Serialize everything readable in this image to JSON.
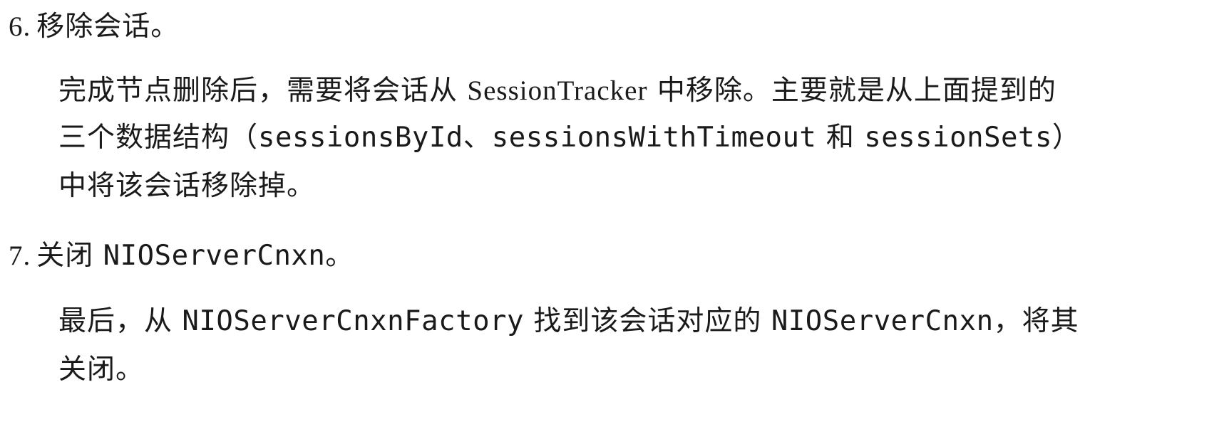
{
  "items": [
    {
      "number": "6.",
      "heading": "移除会话。",
      "body": {
        "line1_a": "完成节点删除后，需要将会话从 ",
        "line1_b": "SessionTracker",
        "line1_c": " 中移除。主要就是从上面提到的",
        "line2_a": "三个数据结构（",
        "line2_b": "sessionsById",
        "line2_c": "、",
        "line2_d": "sessionsWithTimeout",
        "line2_e": " 和 ",
        "line2_f": "sessionSets",
        "line2_g": "）",
        "line3": "中将该会话移除掉。"
      }
    },
    {
      "number": "7.",
      "heading_a": "关闭 ",
      "heading_b": "NIOServerCnxn",
      "heading_c": "。",
      "body": {
        "line1_a": "最后，从 ",
        "line1_b": "NIOServerCnxnFactory",
        "line1_c": " 找到该会话对应的 ",
        "line1_d": "NIOServerCnxn",
        "line1_e": "，将其",
        "line2": "关闭。"
      }
    }
  ]
}
